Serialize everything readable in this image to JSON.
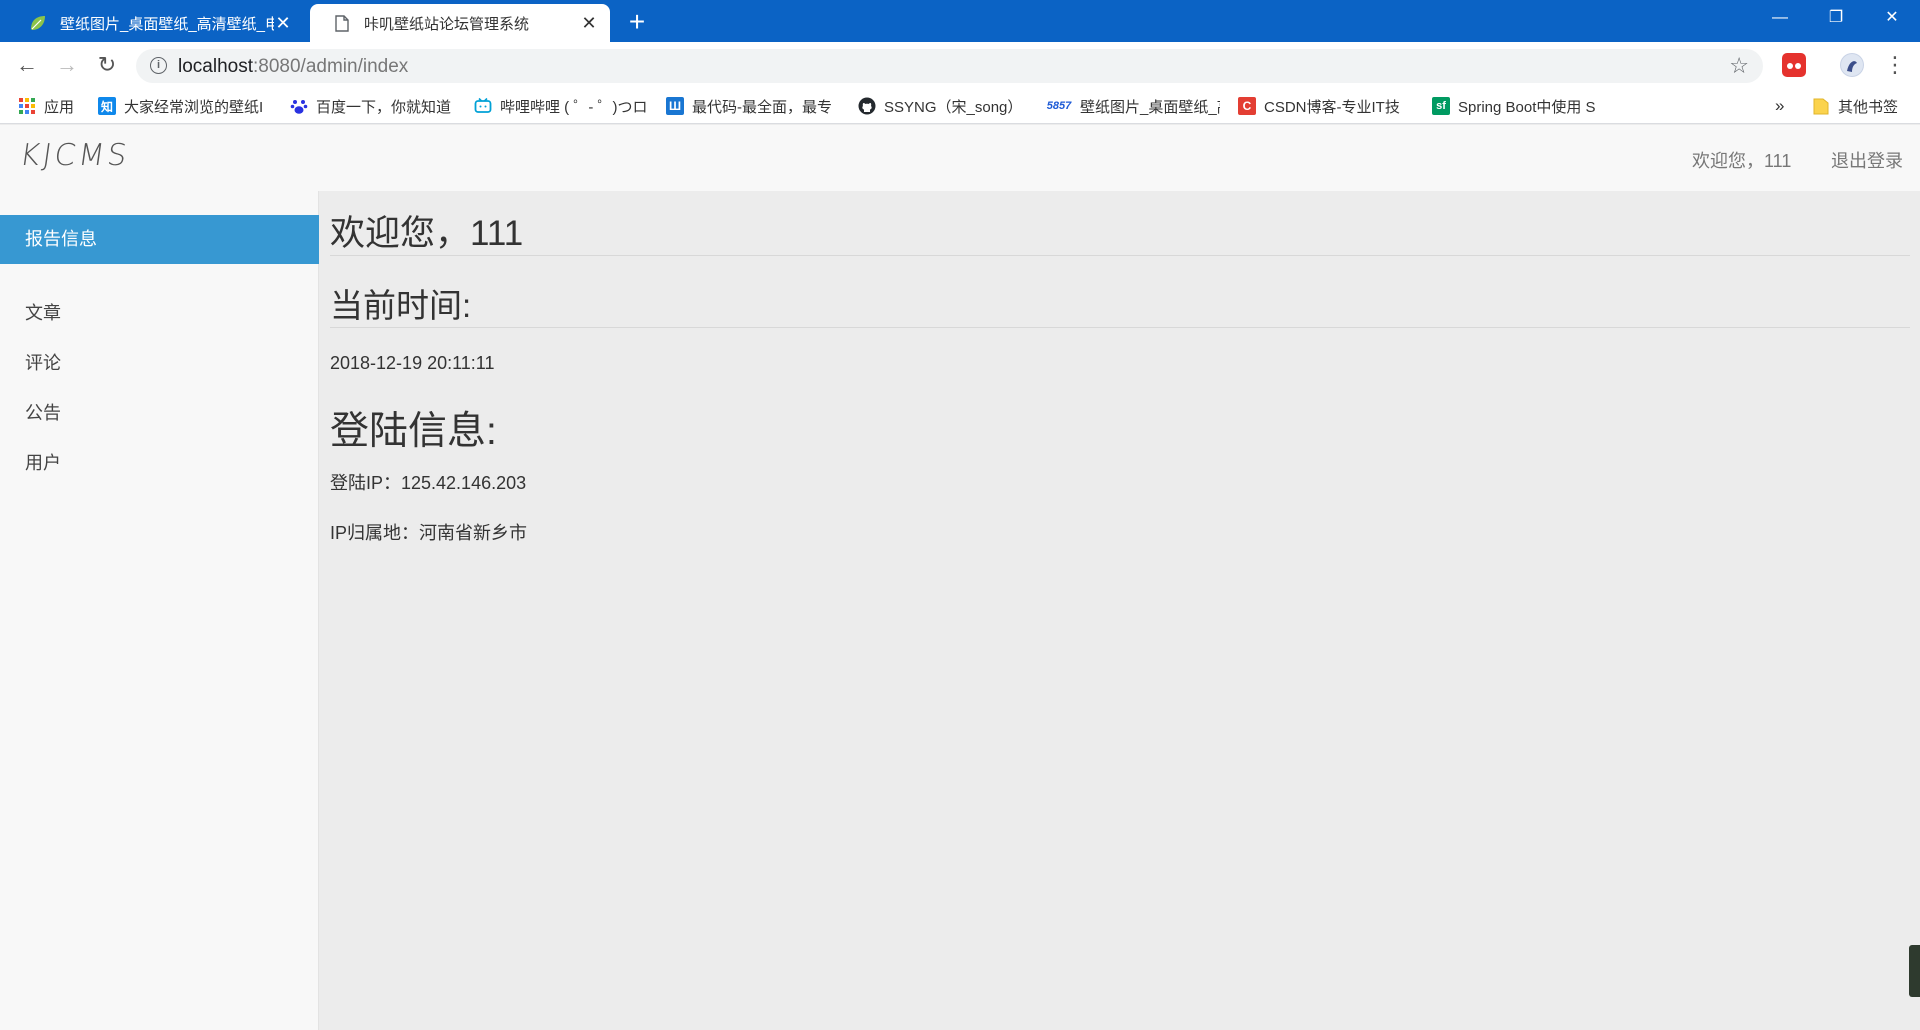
{
  "browser": {
    "tabs": [
      {
        "title": "壁纸图片_桌面壁纸_高清壁纸_电脑壁纸",
        "close": "✕"
      },
      {
        "title": "咔叽壁纸站论坛管理系统",
        "close": "✕"
      }
    ],
    "new_tab": "+",
    "window": {
      "minimize": "—",
      "restore": "❐",
      "close": "✕"
    },
    "nav": {
      "back": "←",
      "forward": "→",
      "reload": "↻"
    },
    "url_host": "localhost",
    "url_rest": ":8080/admin/index",
    "info": "i",
    "star": "☆",
    "menu": "⋮",
    "bookmarks": [
      {
        "label": "应用",
        "icon": "apps-grid-icon",
        "color": "#e94235"
      },
      {
        "label": "大家经常浏览的壁纸I",
        "icon": "zhihu-icon",
        "badge": "知",
        "color": "#0f88eb"
      },
      {
        "label": "百度一下，你就知道",
        "icon": "baidu-paw-icon",
        "color": "#2932e1"
      },
      {
        "label": "哔哩哔哩 ( ゜- ゜)つロ",
        "icon": "bilibili-tv-icon",
        "color": "#00a1d6"
      },
      {
        "label": "最代码-最全面，最专",
        "icon": "zuidaima-icon",
        "badge": "Ш",
        "color": "#1976d2"
      },
      {
        "label": "SSYNG（宋_song）",
        "icon": "github-icon",
        "color": "#24292e"
      },
      {
        "label": "壁纸图片_桌面壁纸_高",
        "icon": "5857-icon",
        "badge": "5857",
        "color": "#1e5bd6"
      },
      {
        "label": "CSDN博客-专业IT技",
        "icon": "csdn-icon",
        "badge": "C",
        "color": "#e33e33"
      },
      {
        "label": "Spring Boot中使用 S",
        "icon": "segmentfault-icon",
        "badge": "sf",
        "color": "#009a61"
      }
    ],
    "more": "»",
    "other_bookmarks": "其他书签"
  },
  "header": {
    "logo": "KJCMS",
    "welcome": "欢迎您，111",
    "logout": "退出登录"
  },
  "sidebar": {
    "items": [
      {
        "label": "报告信息",
        "active": true
      },
      {
        "label": "文章"
      },
      {
        "label": "评论"
      },
      {
        "label": "公告"
      },
      {
        "label": "用户"
      }
    ]
  },
  "main": {
    "welcome_heading": "欢迎您，111",
    "time_heading": "当前时间:",
    "time_value": "2018-12-19 20:11:11",
    "login_heading": "登陆信息:",
    "login_ip": "登陆IP：125.42.146.203",
    "ip_location": "IP归属地：河南省新乡市"
  },
  "colors": {
    "chrome_blue": "#0b63c5",
    "sidebar_active": "#3798d2",
    "page_bg": "#ececec",
    "header_bg": "#f8f8f8"
  }
}
